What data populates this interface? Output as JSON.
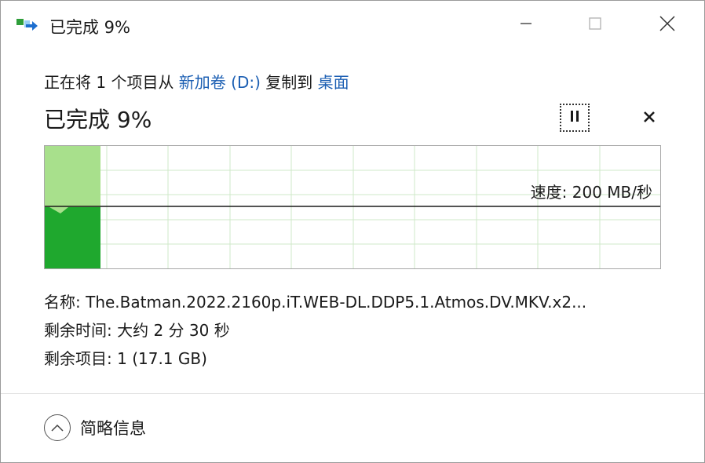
{
  "window": {
    "title": "已完成 9%"
  },
  "header": {
    "desc_prefix": "正在将 1 个项目从 ",
    "source": "新加卷 (D:)",
    "desc_middle": " 复制到 ",
    "destination": "桌面",
    "progress_title": "已完成 9%"
  },
  "graph": {
    "speed_label": "速度: 200 MB/秒",
    "percent_complete": 9
  },
  "details": {
    "name_label": "名称: ",
    "name_value": "The.Batman.2022.2160p.iT.WEB-DL.DDP5.1.Atmos.DV.MKV.x2...",
    "time_label": "剩余时间: ",
    "time_value": "大约 2 分 30 秒",
    "items_label": "剩余项目: ",
    "items_value": "1 (17.1 GB)"
  },
  "footer": {
    "collapse_label": "简略信息"
  },
  "icons": {
    "app": "copy-arrow-icon",
    "minimize": "minimize-icon",
    "maximize": "maximize-icon",
    "close": "close-icon",
    "pause": "pause-icon",
    "cancel": "cancel-icon",
    "collapse": "chevron-up-icon"
  },
  "colors": {
    "link": "#1c5fb3",
    "progress_light": "#a8e08c",
    "progress_dark": "#1fa82e",
    "grid": "#cfe8c8"
  }
}
